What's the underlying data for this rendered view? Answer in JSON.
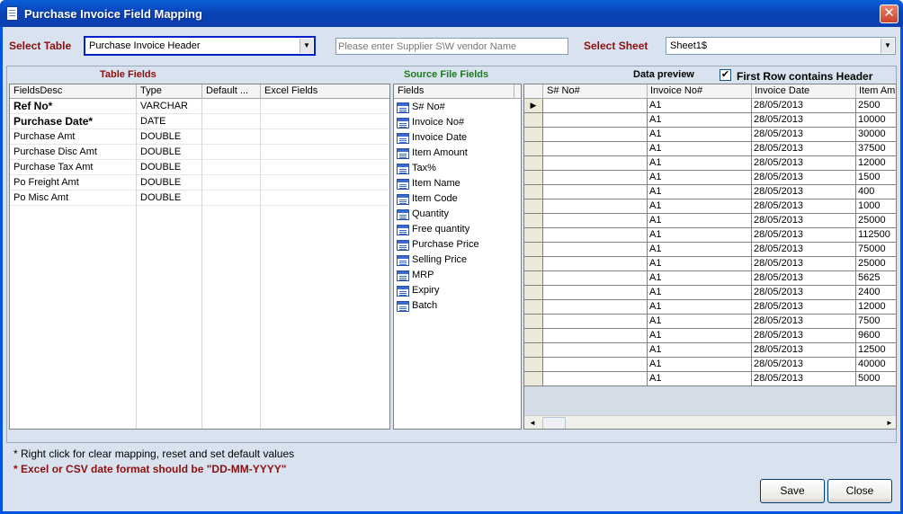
{
  "window": {
    "title": "Purchase Invoice Field Mapping",
    "close_glyph": "✕"
  },
  "top": {
    "select_table_label": "Select Table",
    "select_table_value": "Purchase Invoice Header",
    "vendor_placeholder": "Please enter Supplier S\\W vendor Name",
    "select_sheet_label": "Select Sheet",
    "select_sheet_value": "Sheet1$",
    "dropdown_arrow": "▼"
  },
  "table_fields": {
    "title": "Table Fields",
    "title_color": "#8b0f0f",
    "columns": [
      "FieldsDesc",
      "Type",
      "Default ...",
      "Excel Fields"
    ],
    "rows": [
      {
        "desc": "Ref No*",
        "type": "VARCHAR",
        "bold": true
      },
      {
        "desc": "Purchase Date*",
        "type": "DATE",
        "bold": true
      },
      {
        "desc": "Purchase Amt",
        "type": "DOUBLE",
        "bold": false
      },
      {
        "desc": "Purchase Disc Amt",
        "type": "DOUBLE",
        "bold": false
      },
      {
        "desc": "Purchase Tax Amt",
        "type": "DOUBLE",
        "bold": false
      },
      {
        "desc": "Po Freight Amt",
        "type": "DOUBLE",
        "bold": false
      },
      {
        "desc": "Po Misc Amt",
        "type": "DOUBLE",
        "bold": false
      }
    ]
  },
  "source_fields": {
    "title": "Source File Fields",
    "title_color": "#1e7a1e",
    "header": "Fields",
    "items": [
      "S# No#",
      "Invoice No#",
      "Invoice Date",
      "Item Amount",
      "Tax%",
      "Item Name",
      "Item Code",
      "Quantity",
      "Free quantity",
      "Purchase Price",
      "Selling Price",
      "MRP",
      "Expiry",
      "Batch"
    ]
  },
  "data_preview": {
    "title": "Data preview",
    "first_row_header_label": "First Row contains Header",
    "first_row_header_checked": "✔",
    "current_row_glyph": "▶",
    "columns": [
      "S# No#",
      "Invoice No#",
      "Invoice Date",
      "Item Am"
    ],
    "rows": [
      [
        "",
        "A1",
        "28/05/2013",
        "2500"
      ],
      [
        "",
        "A1",
        "28/05/2013",
        "10000"
      ],
      [
        "",
        "A1",
        "28/05/2013",
        "30000"
      ],
      [
        "",
        "A1",
        "28/05/2013",
        "37500"
      ],
      [
        "",
        "A1",
        "28/05/2013",
        "12000"
      ],
      [
        "",
        "A1",
        "28/05/2013",
        "1500"
      ],
      [
        "",
        "A1",
        "28/05/2013",
        "400"
      ],
      [
        "",
        "A1",
        "28/05/2013",
        "1000"
      ],
      [
        "",
        "A1",
        "28/05/2013",
        "25000"
      ],
      [
        "",
        "A1",
        "28/05/2013",
        "112500"
      ],
      [
        "",
        "A1",
        "28/05/2013",
        "75000"
      ],
      [
        "",
        "A1",
        "28/05/2013",
        "25000"
      ],
      [
        "",
        "A1",
        "28/05/2013",
        "5625"
      ],
      [
        "",
        "A1",
        "28/05/2013",
        "2400"
      ],
      [
        "",
        "A1",
        "28/05/2013",
        "12000"
      ],
      [
        "",
        "A1",
        "28/05/2013",
        "7500"
      ],
      [
        "",
        "A1",
        "28/05/2013",
        "9600"
      ],
      [
        "",
        "A1",
        "28/05/2013",
        "12500"
      ],
      [
        "",
        "A1",
        "28/05/2013",
        "40000"
      ],
      [
        "",
        "A1",
        "28/05/2013",
        "5000"
      ]
    ],
    "scroll_left": "◄",
    "scroll_right": "►"
  },
  "footer": {
    "note1": "* Right click for clear mapping, reset and set default values",
    "note2": "* Excel or CSV date format should be \"DD-MM-YYYY\"",
    "note2_color": "#8b0f0f",
    "save_label": "Save",
    "close_label": "Close"
  }
}
